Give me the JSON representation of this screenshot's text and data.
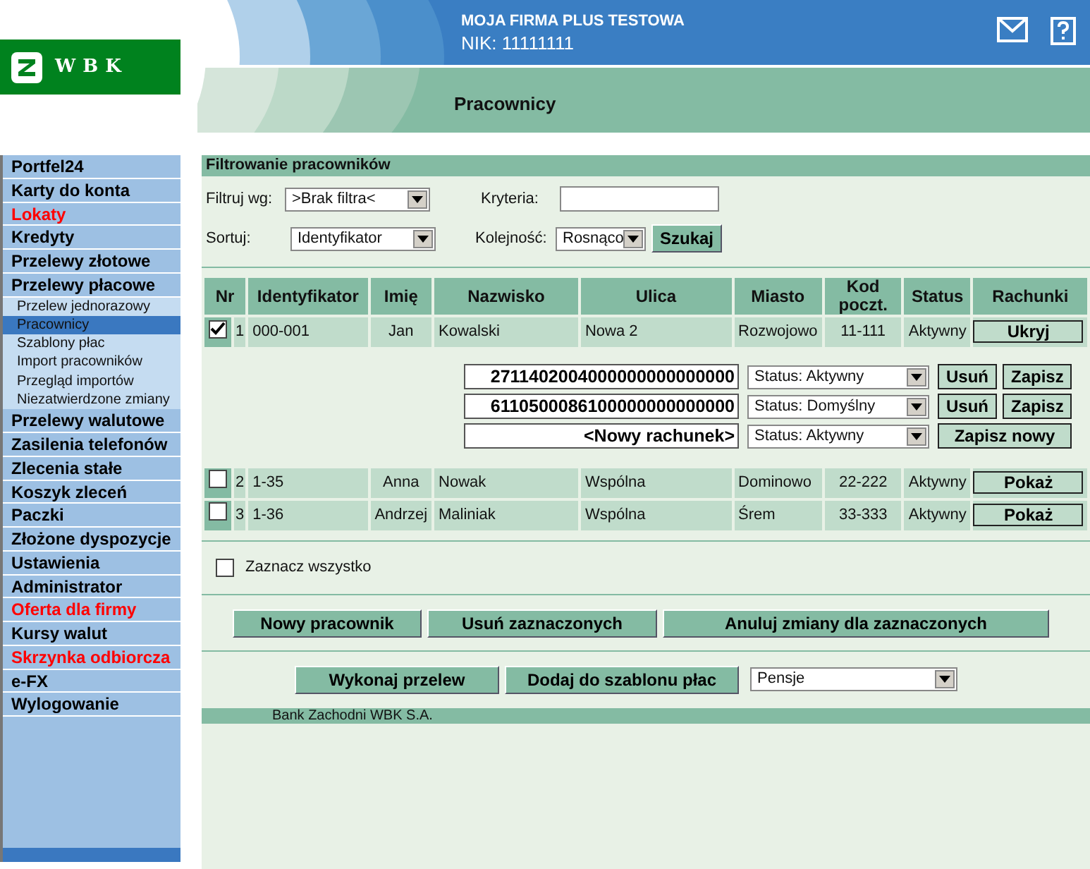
{
  "header": {
    "logo": "WBK",
    "company": "MOJA FIRMA PLUS TESTOWA",
    "nik": "NIK: 11111111",
    "page_title": "Pracownicy"
  },
  "sidebar": {
    "items": [
      {
        "label": "Portfel24",
        "kind": "main",
        "highlighted": false,
        "selected": false
      },
      {
        "label": "Karty do konta",
        "kind": "main",
        "highlighted": false,
        "selected": false
      },
      {
        "label": "Lokaty",
        "kind": "main",
        "highlighted": true,
        "selected": false
      },
      {
        "label": "Kredyty",
        "kind": "main",
        "highlighted": false,
        "selected": false
      },
      {
        "label": "Przelewy złotowe",
        "kind": "main",
        "highlighted": false,
        "selected": false
      },
      {
        "label": "Przelewy płacowe",
        "kind": "main",
        "highlighted": false,
        "selected": false
      },
      {
        "label": "Przelew jednorazowy",
        "kind": "sub",
        "selected": false
      },
      {
        "label": "Pracownicy",
        "kind": "sub",
        "selected": true
      },
      {
        "label": "Szablony płac",
        "kind": "sub",
        "selected": false
      },
      {
        "label": "Import pracowników",
        "kind": "sub",
        "selected": false
      },
      {
        "label": "Przegląd importów",
        "kind": "sub",
        "selected": false
      },
      {
        "label": "Niezatwierdzone zmiany",
        "kind": "sub",
        "selected": false
      },
      {
        "label": "Przelewy walutowe",
        "kind": "main",
        "highlighted": false,
        "selected": false
      },
      {
        "label": "Zasilenia telefonów",
        "kind": "main",
        "highlighted": false,
        "selected": false
      },
      {
        "label": "Zlecenia stałe",
        "kind": "main",
        "highlighted": false,
        "selected": false
      },
      {
        "label": "Koszyk zleceń",
        "kind": "main",
        "highlighted": false,
        "selected": false
      },
      {
        "label": "Paczki",
        "kind": "main",
        "highlighted": false,
        "selected": false
      },
      {
        "label": "Złożone dyspozycje",
        "kind": "main",
        "highlighted": false,
        "selected": false
      },
      {
        "label": "Ustawienia",
        "kind": "main",
        "highlighted": false,
        "selected": false
      },
      {
        "label": "Administrator",
        "kind": "main",
        "highlighted": false,
        "selected": false
      },
      {
        "label": "Oferta dla firmy",
        "kind": "main",
        "highlighted": true,
        "selected": false
      },
      {
        "label": "Kursy walut",
        "kind": "main",
        "highlighted": false,
        "selected": false
      },
      {
        "label": "Skrzynka odbiorcza",
        "kind": "main",
        "highlighted": true,
        "selected": false
      },
      {
        "label": "e-FX",
        "kind": "main",
        "highlighted": false,
        "selected": false
      },
      {
        "label": "Wylogowanie",
        "kind": "main",
        "highlighted": false,
        "selected": false
      }
    ]
  },
  "filter": {
    "title": "Filtrowanie pracowników",
    "filter_label": "Filtruj wg:",
    "filter_value": ">Brak filtra<",
    "criteria_label": "Kryteria:",
    "sort_label": "Sortuj:",
    "sort_value": "Identyfikator",
    "order_label": "Kolejność:",
    "order_value": "Rosnąco",
    "search_button": "Szukaj"
  },
  "table": {
    "columns": [
      "Nr",
      "Identyfikator",
      "Imię",
      "Nazwisko",
      "Ulica",
      "Miasto",
      "Kod poczt.",
      "Status",
      "Rachunki"
    ],
    "rows": [
      {
        "checked": true,
        "nr": "1",
        "id": "000-001",
        "first_name": "Jan",
        "last_name": "Kowalski",
        "street": "Nowa 2",
        "city": "Rozwojowo",
        "postcode": "11-111",
        "status": "Aktywny",
        "action": "Ukryj",
        "accounts": [
          {
            "number": "2711402004000000000000000",
            "status": "Status: Aktywny",
            "buttons": [
              "Usuń",
              "Zapisz"
            ]
          },
          {
            "number": "6110500086100000000000000",
            "status": "Status: Domyślny",
            "buttons": [
              "Usuń",
              "Zapisz"
            ]
          },
          {
            "number": "<Nowy rachunek>",
            "status": "Status: Aktywny",
            "buttons": [
              "Zapisz nowy"
            ]
          }
        ]
      },
      {
        "checked": false,
        "nr": "2",
        "id": "1-35",
        "first_name": "Anna",
        "last_name": "Nowak",
        "street": "Wspólna",
        "city": "Dominowo",
        "postcode": "22-222",
        "status": "Aktywny",
        "action": "Pokaż"
      },
      {
        "checked": false,
        "nr": "3",
        "id": "1-36",
        "first_name": "Andrzej",
        "last_name": "Maliniak",
        "street": "Wspólna",
        "city": "Śrem",
        "postcode": "33-333",
        "status": "Aktywny",
        "action": "Pokaż"
      }
    ]
  },
  "select_all": {
    "label": "Zaznacz wszystko",
    "checked": false
  },
  "actions": [
    "Nowy pracownik",
    "Usuń zaznaczonych",
    "Anuluj zmiany dla zaznaczonych"
  ],
  "transfer": {
    "buttons": [
      "Wykonaj przelew",
      "Dodaj do szablonu płac"
    ],
    "template": "Pensje"
  },
  "footer": "Bank Zachodni WBK S.A."
}
